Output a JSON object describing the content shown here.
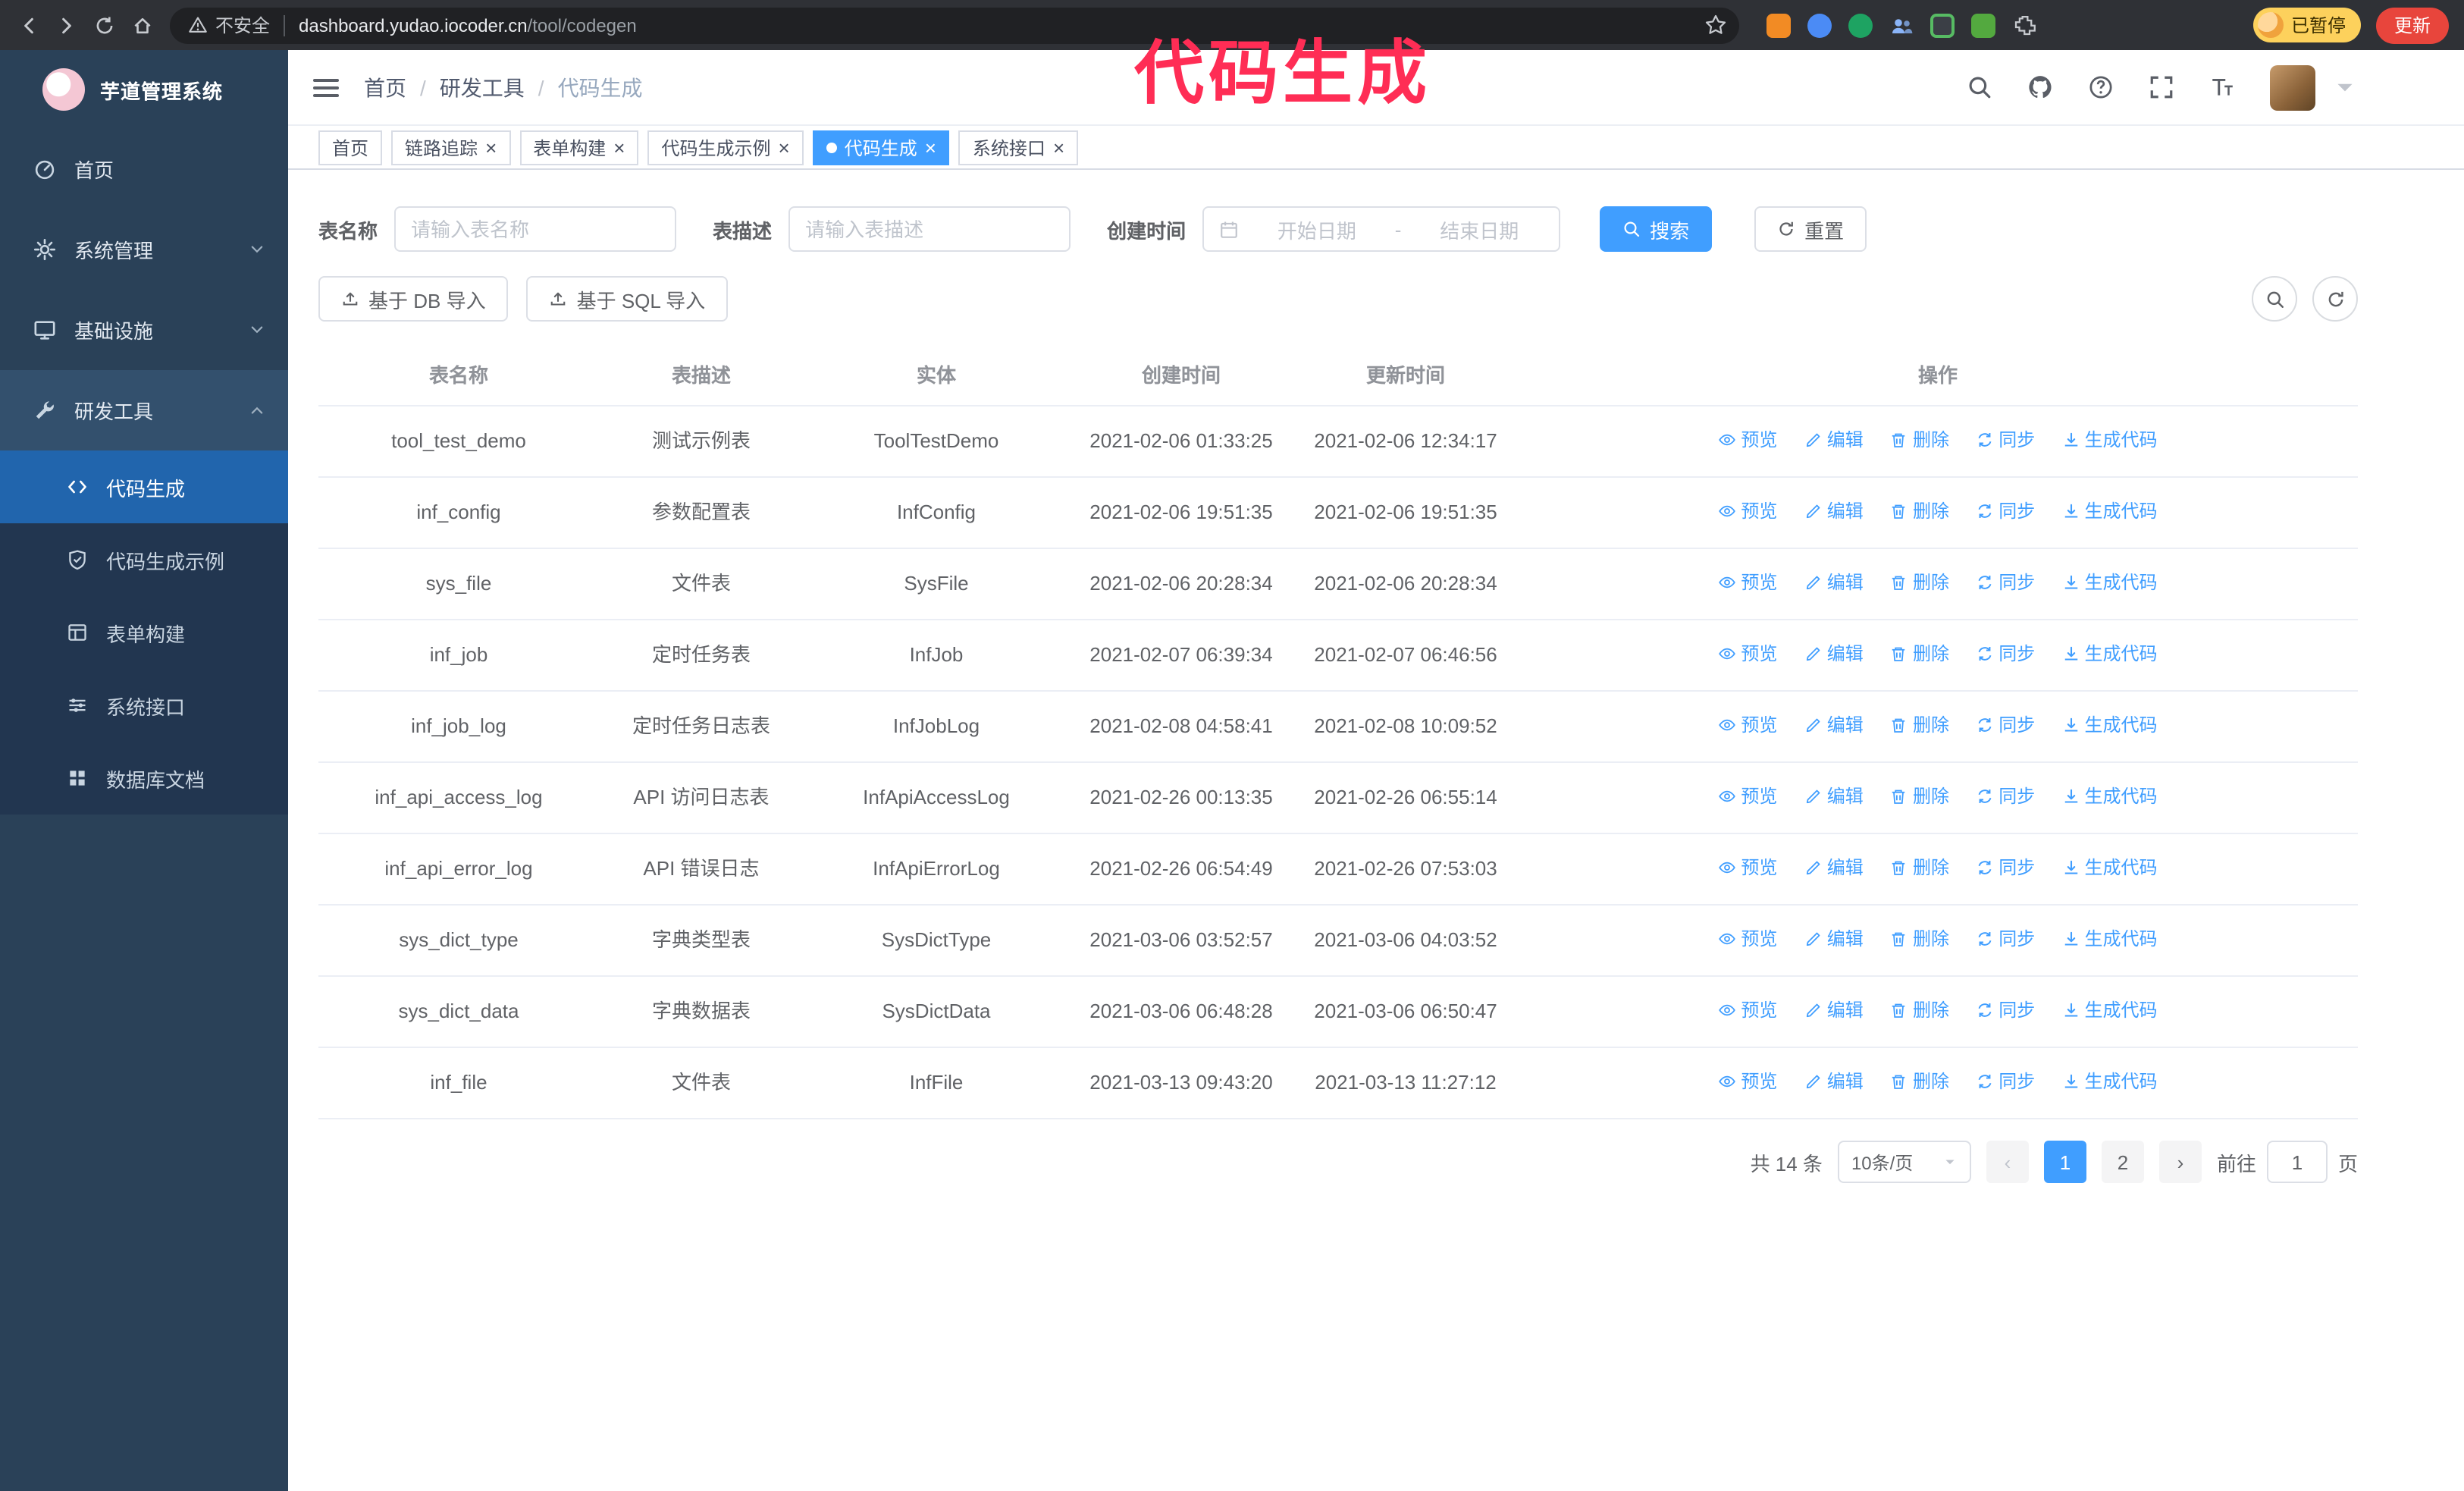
{
  "annotation": {
    "label": "代码生成"
  },
  "colors": {
    "primary": "#409eff",
    "annotation": "#ff2d55",
    "sidebar_bg": "#2a4158",
    "active_tab": "#409eff"
  },
  "glyphs": {
    "close": "×",
    "prev": "‹",
    "next": "›",
    "breadcrumb_separator": "/"
  },
  "browser": {
    "insecure_label": "不安全",
    "url_host": "dashboard.yudao.iocoder.cn",
    "url_path": "/tool/codegen",
    "paused_badge": "已暂停",
    "update_label": "更新"
  },
  "sidebar": {
    "logo_title": "芋道管理系统",
    "items": {
      "home": "首页",
      "system": "系统管理",
      "infra": "基础设施",
      "devtools": "研发工具"
    },
    "sub_items": {
      "codegen": "代码生成",
      "codegen_example": "代码生成示例",
      "form_builder": "表单构建",
      "api": "系统接口",
      "db_doc": "数据库文档"
    }
  },
  "navbar": {
    "breadcrumb": [
      "首页",
      "研发工具",
      "代码生成"
    ]
  },
  "tabs": [
    {
      "label": "首页",
      "active": false,
      "closable": false
    },
    {
      "label": "链路追踪",
      "active": false,
      "closable": true
    },
    {
      "label": "表单构建",
      "active": false,
      "closable": true
    },
    {
      "label": "代码生成示例",
      "active": false,
      "closable": true
    },
    {
      "label": "代码生成",
      "active": true,
      "closable": true
    },
    {
      "label": "系统接口",
      "active": false,
      "closable": true
    }
  ],
  "filters": {
    "table_name_label": "表名称",
    "table_name_placeholder": "请输入表名称",
    "table_desc_label": "表描述",
    "table_desc_placeholder": "请输入表描述",
    "create_time_label": "创建时间",
    "date_start_placeholder": "开始日期",
    "date_separator": "-",
    "date_end_placeholder": "结束日期",
    "search_button": "搜索",
    "reset_button": "重置"
  },
  "toolbar": {
    "import_db_button": "基于 DB 导入",
    "import_sql_button": "基于 SQL 导入"
  },
  "table": {
    "columns": [
      "表名称",
      "表描述",
      "实体",
      "创建时间",
      "更新时间",
      "操作"
    ],
    "actions": [
      "预览",
      "编辑",
      "删除",
      "同步",
      "生成代码"
    ],
    "rows": [
      {
        "name": "tool_test_demo",
        "desc": "测试示例表",
        "entity": "ToolTestDemo",
        "created": "2021-02-06 01:33:25",
        "updated": "2021-02-06 12:34:17"
      },
      {
        "name": "inf_config",
        "desc": "参数配置表",
        "entity": "InfConfig",
        "created": "2021-02-06 19:51:35",
        "updated": "2021-02-06 19:51:35"
      },
      {
        "name": "sys_file",
        "desc": "文件表",
        "entity": "SysFile",
        "created": "2021-02-06 20:28:34",
        "updated": "2021-02-06 20:28:34"
      },
      {
        "name": "inf_job",
        "desc": "定时任务表",
        "entity": "InfJob",
        "created": "2021-02-07 06:39:34",
        "updated": "2021-02-07 06:46:56"
      },
      {
        "name": "inf_job_log",
        "desc": "定时任务日志表",
        "entity": "InfJobLog",
        "created": "2021-02-08 04:58:41",
        "updated": "2021-02-08 10:09:52"
      },
      {
        "name": "inf_api_access_log",
        "desc": "API 访问日志表",
        "entity": "InfApiAccessLog",
        "created": "2021-02-26 00:13:35",
        "updated": "2021-02-26 06:55:14"
      },
      {
        "name": "inf_api_error_log",
        "desc": "API 错误日志",
        "entity": "InfApiErrorLog",
        "created": "2021-02-26 06:54:49",
        "updated": "2021-02-26 07:53:03"
      },
      {
        "name": "sys_dict_type",
        "desc": "字典类型表",
        "entity": "SysDictType",
        "created": "2021-03-06 03:52:57",
        "updated": "2021-03-06 04:03:52"
      },
      {
        "name": "sys_dict_data",
        "desc": "字典数据表",
        "entity": "SysDictData",
        "created": "2021-03-06 06:48:28",
        "updated": "2021-03-06 06:50:47"
      },
      {
        "name": "inf_file",
        "desc": "文件表",
        "entity": "InfFile",
        "created": "2021-03-13 09:43:20",
        "updated": "2021-03-13 11:27:12"
      }
    ]
  },
  "pagination": {
    "total": "共 14 条",
    "page_size": "10条/页",
    "pages": [
      "1",
      "2"
    ],
    "goto_label": "前往",
    "goto_value": "1",
    "page_unit": "页"
  }
}
